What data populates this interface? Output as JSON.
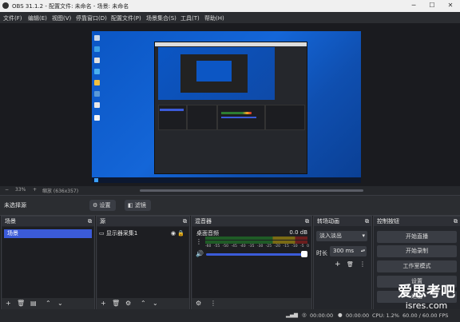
{
  "window": {
    "title": "OBS 31.1.2 - 配置文件: 未命名 - 场景: 未命名",
    "minimize": "─",
    "maximize": "☐",
    "close": "✕"
  },
  "menu": [
    "文件(F)",
    "编辑(E)",
    "视图(V)",
    "停靠窗口(D)",
    "配置文件(P)",
    "场景集合(S)",
    "工具(T)",
    "帮助(H)"
  ],
  "zoom": {
    "minus": "−",
    "percent": "33%",
    "plus": "+",
    "info": "缩放 (636x357)"
  },
  "source_toolbar": {
    "status": "未选择源",
    "settings": "设置",
    "filters": "滤镜"
  },
  "scenes": {
    "title": "场景",
    "items": [
      "场景"
    ]
  },
  "sources": {
    "title": "源",
    "items": [
      "显示器采集1"
    ]
  },
  "mixer": {
    "title": "混音器",
    "track": "桌面音频",
    "level": "0.0 dB",
    "scale": [
      "-60",
      "-55",
      "-50",
      "-45",
      "-40",
      "-35",
      "-30",
      "-25",
      "-20",
      "-15",
      "-10",
      "-5",
      "0"
    ]
  },
  "transitions": {
    "title": "转场动画",
    "selected": "淡入淡出",
    "duration_label": "时长",
    "duration": "300 ms"
  },
  "controls": {
    "title": "控制按钮",
    "buttons": [
      "开始直播",
      "开始录制",
      "工作室模式",
      "设置",
      "退出"
    ]
  },
  "status": {
    "stream_time": "00:00:00",
    "rec_time": "00:00:00",
    "cpu": "CPU: 1.2%",
    "fps": "60.00 / 60.00 FPS"
  },
  "watermark": {
    "line1": "爱思考吧",
    "line2": "isres.com"
  },
  "colors": {
    "accent": "#3b5bd9",
    "panel": "#24262b",
    "desktop": "#0b56c4"
  }
}
